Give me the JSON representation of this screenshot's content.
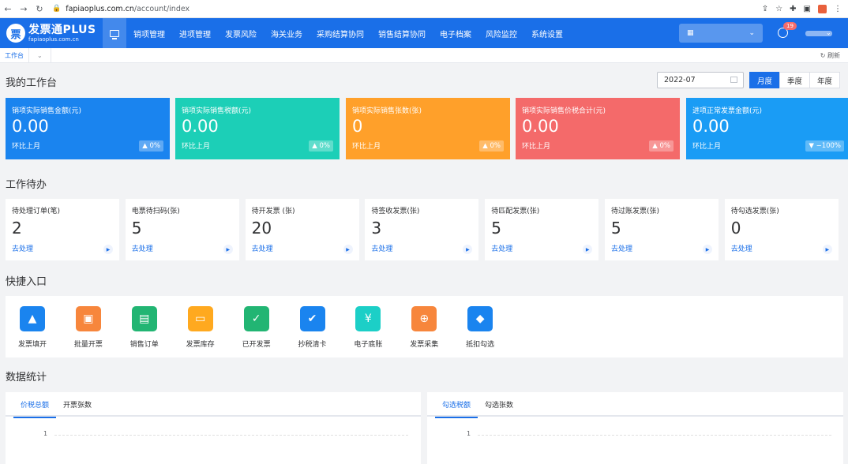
{
  "browser": {
    "domain": "fapiaoplus.com.cn",
    "path": "/account/index"
  },
  "logo": {
    "badge": "票",
    "main": "发票通PLUS",
    "sub": "fapiaoplus.com.cn"
  },
  "menu": [
    "销项管理",
    "进项管理",
    "发票风险",
    "海关业务",
    "采购结算协同",
    "销售结算协同",
    "电子档案",
    "风险监控",
    "系统设置"
  ],
  "header": {
    "notification_count": "19"
  },
  "tabs": {
    "current": "工作台",
    "refresh": "刷新"
  },
  "workbench": {
    "title": "我的工作台",
    "month": "2022-07",
    "periods": [
      "月度",
      "季度",
      "年度"
    ],
    "active_period": "月度",
    "stats": [
      {
        "label": "销项实际销售金额(元)",
        "value": "0.00",
        "sub": "环比上月",
        "change": "▲ 0%",
        "color": "#1a84ef"
      },
      {
        "label": "销项实际销售税额(元)",
        "value": "0.00",
        "sub": "环比上月",
        "change": "▲ 0%",
        "color": "#1ccfb7"
      },
      {
        "label": "销项实际销售张数(张)",
        "value": "0",
        "sub": "环比上月",
        "change": "▲ 0%",
        "color": "#ffa02a"
      },
      {
        "label": "销项实际销售价税合计(元)",
        "value": "0.00",
        "sub": "环比上月",
        "change": "▲ 0%",
        "color": "#f46a6a"
      },
      {
        "label": "进项正常发票金额(元)",
        "value": "0.00",
        "sub": "环比上月",
        "change": "▼ −100%",
        "color": "#1a9cf5"
      }
    ]
  },
  "todo": {
    "title": "工作待办",
    "items": [
      {
        "label": "待处理订单(笔)",
        "value": "2",
        "link": "去处理"
      },
      {
        "label": "电票待扫码(张)",
        "value": "5",
        "link": "去处理"
      },
      {
        "label": "待开发票 (张)",
        "value": "20",
        "link": "去处理"
      },
      {
        "label": "待签收发票(张)",
        "value": "3",
        "link": "去处理"
      },
      {
        "label": "待匹配发票(张)",
        "value": "5",
        "link": "去处理"
      },
      {
        "label": "待过账发票(张)",
        "value": "5",
        "link": "去处理"
      },
      {
        "label": "待勾选发票(张)",
        "value": "0",
        "link": "去处理"
      }
    ]
  },
  "quick": {
    "title": "快捷入口",
    "items": [
      {
        "label": "发票填开",
        "icon": "user-icon",
        "color": "#1a84ef",
        "glyph": "▲"
      },
      {
        "label": "批量开票",
        "icon": "copy-icon",
        "color": "#f7863c",
        "glyph": "▣"
      },
      {
        "label": "销售订单",
        "icon": "order-icon",
        "color": "#22b573",
        "glyph": "▤"
      },
      {
        "label": "发票库存",
        "icon": "inventory-icon",
        "color": "#ffa91f",
        "glyph": "▭"
      },
      {
        "label": "已开发票",
        "icon": "check-icon",
        "color": "#22b573",
        "glyph": "✓"
      },
      {
        "label": "抄税清卡",
        "icon": "clipboard-icon",
        "color": "#1a84ef",
        "glyph": "✔"
      },
      {
        "label": "电子底账",
        "icon": "yen-icon",
        "color": "#1ccfc7",
        "glyph": "¥"
      },
      {
        "label": "发票采集",
        "icon": "collect-icon",
        "color": "#f7863c",
        "glyph": "⊕"
      },
      {
        "label": "抵扣勾选",
        "icon": "box-icon",
        "color": "#1a84ef",
        "glyph": "◆"
      }
    ]
  },
  "stats_section": {
    "title": "数据统计",
    "left_tabs": [
      "价税总额",
      "开票张数"
    ],
    "right_tabs": [
      "勾选税额",
      "勾选张数"
    ],
    "y_tick": "1"
  }
}
